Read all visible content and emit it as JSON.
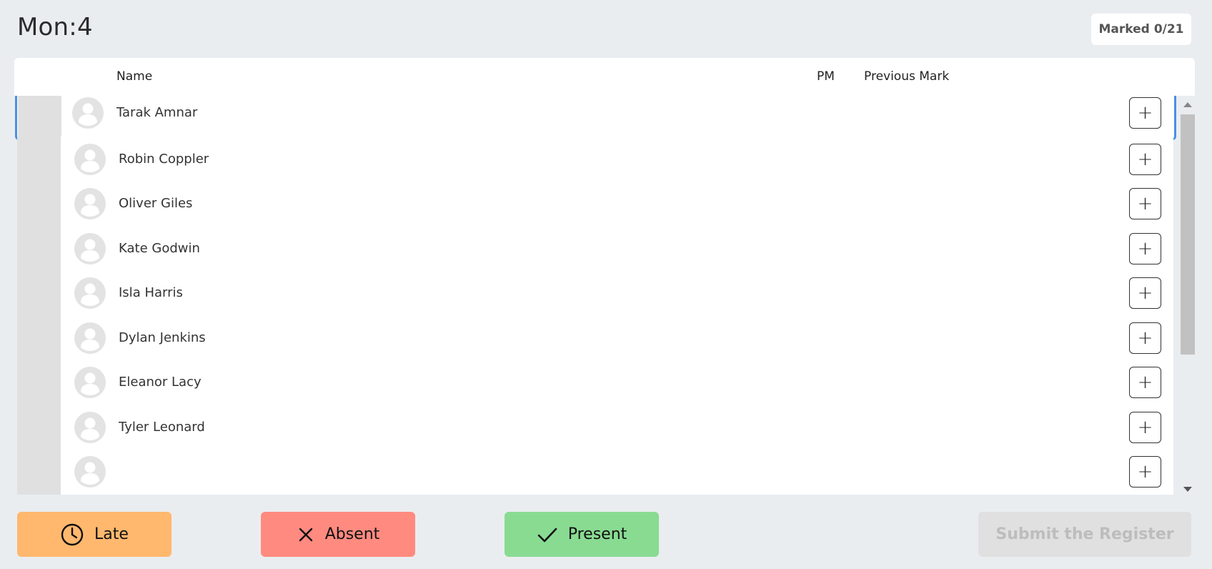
{
  "page": {
    "title": "Mon:4",
    "marked_label": "Marked",
    "marked_count": "0/21"
  },
  "table": {
    "columns": {
      "name": "Name",
      "pm": "PM",
      "previous_mark": "Previous Mark"
    },
    "rows": [
      {
        "name": "Tarak Amnar",
        "selected": true
      },
      {
        "name": "Robin Coppler"
      },
      {
        "name": "Oliver Giles"
      },
      {
        "name": "Kate Godwin"
      },
      {
        "name": "Isla Harris"
      },
      {
        "name": "Dylan Jenkins"
      },
      {
        "name": "Eleanor Lacy"
      },
      {
        "name": "Tyler Leonard"
      },
      {
        "name": ""
      }
    ]
  },
  "actions": {
    "late": "Late",
    "absent": "Absent",
    "present": "Present",
    "submit": "Submit the Register"
  },
  "colors": {
    "late": "#ffb86e",
    "absent": "#ff8a80",
    "present": "#89db92",
    "selected_border": "#4a90e2",
    "background": "#eaedf0"
  },
  "icons": {
    "late": "clock-icon",
    "absent": "x-icon",
    "present": "check-icon",
    "row_add": "plus-icon",
    "avatar": "user-avatar-icon"
  }
}
